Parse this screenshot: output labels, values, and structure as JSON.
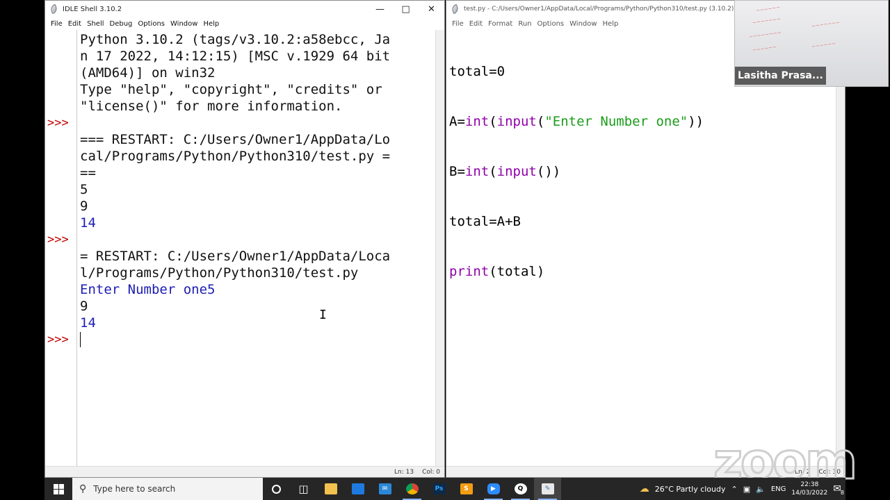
{
  "shell": {
    "title": "IDLE Shell 3.10.2",
    "menu": [
      "File",
      "Edit",
      "Shell",
      "Debug",
      "Options",
      "Window",
      "Help"
    ],
    "lines": [
      {
        "prompt": "",
        "text": "Python 3.10.2 (tags/v3.10.2:a58ebcc, Ja",
        "cls": "out-plain"
      },
      {
        "prompt": "",
        "text": "n 17 2022, 14:12:15) [MSC v.1929 64 bit",
        "cls": "out-plain"
      },
      {
        "prompt": "",
        "text": "(AMD64)] on win32",
        "cls": "out-plain"
      },
      {
        "prompt": "",
        "text": "Type \"help\", \"copyright\", \"credits\" or",
        "cls": "out-plain"
      },
      {
        "prompt": "",
        "text": "\"license()\" for more information.",
        "cls": "out-plain"
      },
      {
        "prompt": ">>>",
        "text": "",
        "cls": "out-plain"
      },
      {
        "prompt": "",
        "text": "=== RESTART: C:/Users/Owner1/AppData/Lo",
        "cls": "out-plain"
      },
      {
        "prompt": "",
        "text": "cal/Programs/Python/Python310/test.py =",
        "cls": "out-plain"
      },
      {
        "prompt": "",
        "text": "==",
        "cls": "out-plain"
      },
      {
        "prompt": "",
        "text": "5",
        "cls": "out-plain"
      },
      {
        "prompt": "",
        "text": "9",
        "cls": "out-plain"
      },
      {
        "prompt": "",
        "text": "14",
        "cls": "out-stdout"
      },
      {
        "prompt": ">>>",
        "text": "",
        "cls": "out-plain"
      },
      {
        "prompt": "",
        "text": "= RESTART: C:/Users/Owner1/AppData/Loca",
        "cls": "out-plain"
      },
      {
        "prompt": "",
        "text": "l/Programs/Python/Python310/test.py",
        "cls": "out-plain"
      },
      {
        "prompt": "",
        "text": "Enter Number one5",
        "cls": "out-stdout"
      },
      {
        "prompt": "",
        "text": "9",
        "cls": "out-plain"
      },
      {
        "prompt": "",
        "text": "14",
        "cls": "out-stdout"
      },
      {
        "prompt": ">>>",
        "text": "",
        "cls": "out-plain"
      }
    ],
    "status_line": "Ln: 13",
    "status_col": "Col: 0"
  },
  "editor": {
    "title": "test.py - C:/Users/Owner1/AppData/Local/Programs/Python/Python310/test.py (3.10.2)",
    "menu": [
      "File",
      "Edit",
      "Format",
      "Run",
      "Options",
      "Window",
      "Help"
    ],
    "code": {
      "l1": "total=0",
      "l2_a": "A=",
      "l2_int": "int",
      "l2_p1": "(",
      "l2_input": "input",
      "l2_p2": "(",
      "l2_str": "\"Enter Number one\"",
      "l2_p3": "))",
      "l3_a": "B=",
      "l3_int": "int",
      "l3_p1": "(",
      "l3_input": "input",
      "l3_p2": "())",
      "l4": "total=A+B",
      "l5_print": "print",
      "l5_rest": "(total)"
    },
    "status_line": "Ln: 2",
    "status_col": "Col: 30"
  },
  "video": {
    "name": "Lasitha Prasa..."
  },
  "zoom_logo": "zoom",
  "taskbar": {
    "search_placeholder": "Type here to search",
    "weather": "26°C  Partly cloudy",
    "lang": "ENG",
    "time": "22:38",
    "date": "14/03/2022",
    "notification_count": "8"
  },
  "colors": {
    "prompt": "#c00000",
    "stdout": "#1d1db4",
    "builtin": "#9000aa",
    "string": "#1b9c1b"
  }
}
